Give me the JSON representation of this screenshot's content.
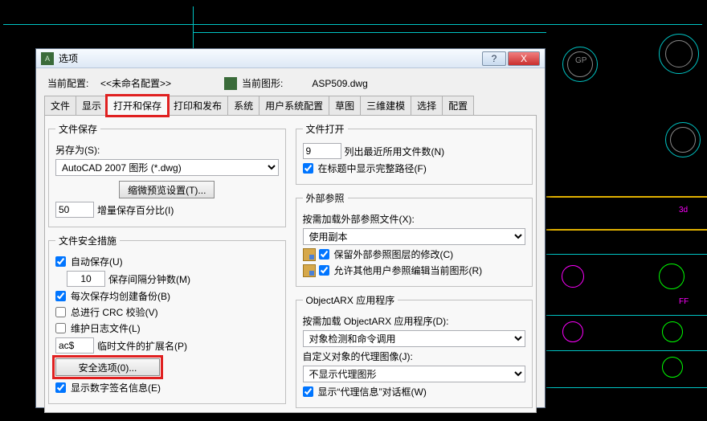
{
  "window": {
    "title": "选项",
    "help_btn": "?",
    "close_btn": "X"
  },
  "config_row": {
    "current_label": "当前配置:",
    "current_value": "<<未命名配置>>",
    "shape_label": "当前图形:",
    "shape_value": "ASP509.dwg"
  },
  "tabs": [
    "文件",
    "显示",
    "打开和保存",
    "打印和发布",
    "系统",
    "用户系统配置",
    "草图",
    "三维建模",
    "选择",
    "配置"
  ],
  "left": {
    "group1_title": "文件保存",
    "save_as_label": "另存为(S):",
    "save_as_value": "AutoCAD 2007 图形 (*.dwg)",
    "thumbnail_btn": "缩微预览设置(T)...",
    "incremental_val": "50",
    "incremental_label": "增量保存百分比(I)",
    "group2_title": "文件安全措施",
    "auto_save_label": "自动保存(U)",
    "auto_save_val": "10",
    "auto_save_unit": "保存间隔分钟数(M)",
    "backup_label": "每次保存均创建备份(B)",
    "crc_label": "总进行 CRC 校验(V)",
    "log_label": "维护日志文件(L)",
    "ext_val": "ac$",
    "ext_label": "临时文件的扩展名(P)",
    "security_btn": "安全选项(0)...",
    "sig_label": "显示数字签名信息(E)"
  },
  "right": {
    "group1_title": "文件打开",
    "recent_val": "9",
    "recent_label": "列出最近所用文件数(N)",
    "fullpath_label": "在标题中显示完整路径(F)",
    "group2_title": "外部参照",
    "xref_load_label": "按需加载外部参照文件(X):",
    "xref_load_val": "使用副本",
    "retain_label": "保留外部参照图层的修改(C)",
    "allow_edit_label": "允许其他用户参照编辑当前图形(R)",
    "group3_title": "ObjectARX 应用程序",
    "arx_load_label": "按需加载 ObjectARX 应用程序(D):",
    "arx_load_val": "对象检测和命令调用",
    "proxy_label": "自定义对象的代理图像(J):",
    "proxy_val": "不显示代理图形",
    "proxy_dlg_label": "显示“代理信息”对话框(W)"
  }
}
